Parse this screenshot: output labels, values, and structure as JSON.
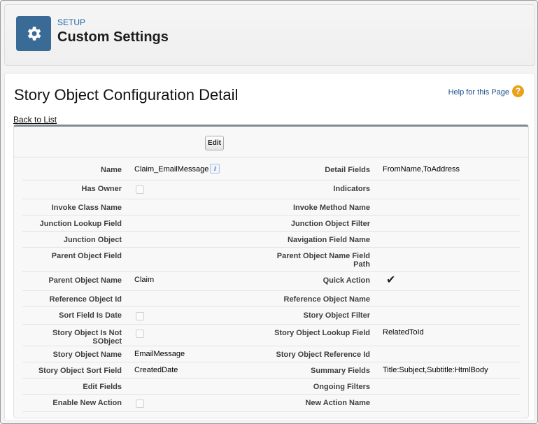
{
  "header": {
    "kicker": "SETUP",
    "title": "Custom Settings",
    "icon": "gear-icon",
    "icon_bg": "#3a6a96"
  },
  "page": {
    "title": "Story Object Configuration Detail",
    "help_link": "Help for this Page",
    "help_icon": "?",
    "back_link": "Back to List",
    "edit_label": "Edit"
  },
  "fields": {
    "name_label": "Name",
    "name_value": "Claim_EmailMessage",
    "detail_fields_label": "Detail Fields",
    "detail_fields_value": "FromName,ToAddress",
    "has_owner_label": "Has Owner",
    "has_owner_checked": false,
    "indicators_label": "Indicators",
    "indicators_value": "",
    "invoke_class_label": "Invoke Class Name",
    "invoke_class_value": "",
    "invoke_method_label": "Invoke Method Name",
    "invoke_method_value": "",
    "junction_lookup_label": "Junction Lookup Field",
    "junction_lookup_value": "",
    "junction_filter_label": "Junction Object Filter",
    "junction_filter_value": "",
    "junction_object_label": "Junction Object",
    "junction_object_value": "",
    "navigation_field_label": "Navigation Field Name",
    "navigation_field_value": "",
    "parent_field_label": "Parent Object Field",
    "parent_field_value": "",
    "parent_name_path_label": "Parent Object Name Field Path",
    "parent_name_path_value": "",
    "parent_name_label": "Parent Object Name",
    "parent_name_value": "Claim",
    "quick_action_label": "Quick Action",
    "quick_action_checked": true,
    "reference_id_label": "Reference Object Id",
    "reference_id_value": "",
    "reference_name_label": "Reference Object Name",
    "reference_name_value": "",
    "sort_is_date_label": "Sort Field Is Date",
    "sort_is_date_checked": false,
    "story_filter_label": "Story Object Filter",
    "story_filter_value": "",
    "not_sobject_label": "Story Object Is Not SObject",
    "not_sobject_checked": false,
    "lookup_field_label": "Story Object Lookup Field",
    "lookup_field_value": "RelatedToId",
    "story_name_label": "Story Object Name",
    "story_name_value": "EmailMessage",
    "story_ref_id_label": "Story Object Reference Id",
    "story_ref_id_value": "",
    "sort_field_label": "Story Object Sort Field",
    "sort_field_value": "CreatedDate",
    "summary_fields_label": "Summary Fields",
    "summary_fields_value": "Title:Subject,Subtitle:HtmlBody",
    "edit_fields_label": "Edit Fields",
    "edit_fields_value": "",
    "ongoing_filters_label": "Ongoing Filters",
    "ongoing_filters_value": "",
    "enable_new_action_label": "Enable New Action",
    "enable_new_action_checked": false,
    "new_action_name_label": "New Action Name",
    "new_action_name_value": ""
  }
}
